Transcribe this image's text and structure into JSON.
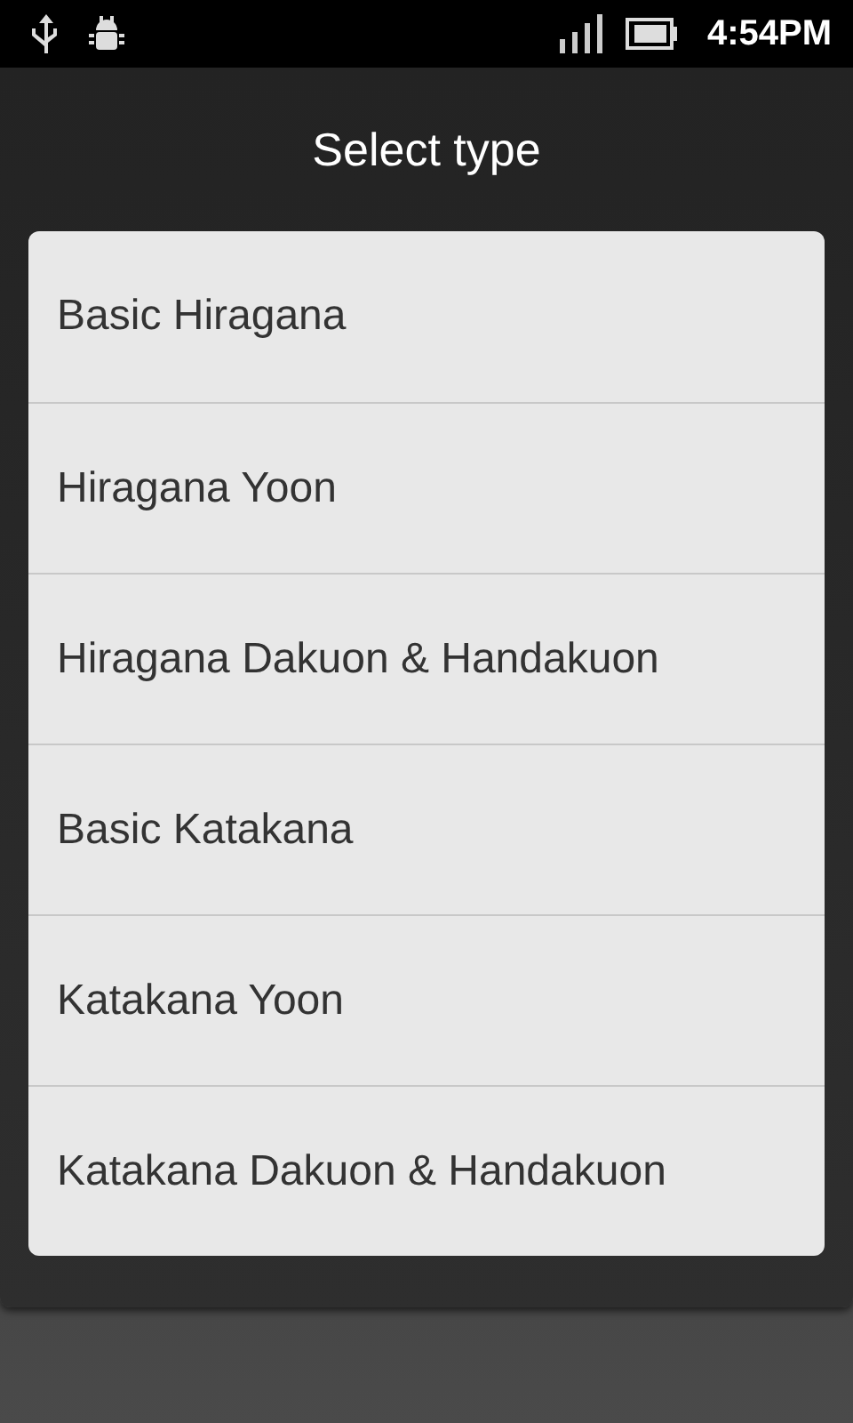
{
  "status_bar": {
    "time": "4:54PM"
  },
  "dialog": {
    "title": "Select type",
    "items": [
      {
        "label": "Basic Hiragana"
      },
      {
        "label": "Hiragana Yoon"
      },
      {
        "label": "Hiragana Dakuon & Handakuon"
      },
      {
        "label": "Basic Katakana"
      },
      {
        "label": "Katakana Yoon"
      },
      {
        "label": "Katakana Dakuon & Handakuon"
      }
    ]
  }
}
